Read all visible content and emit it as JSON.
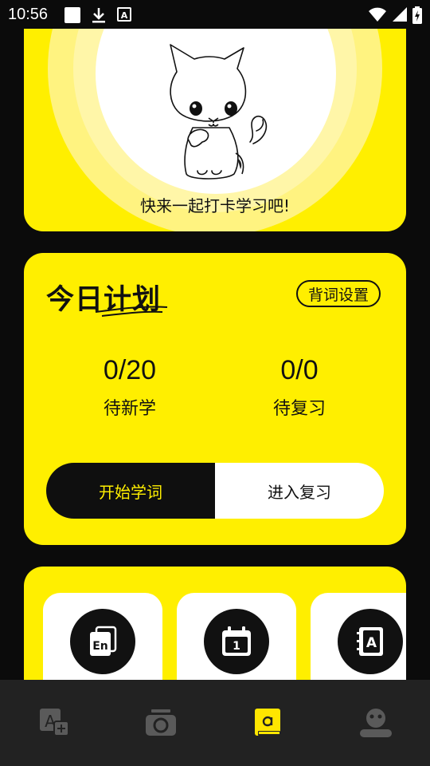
{
  "status_bar": {
    "time": "10:56",
    "notification_icons": [
      "blank-notification-icon",
      "download-icon",
      "translate-a-icon"
    ],
    "system_icons": [
      "wifi-icon",
      "signal-icon",
      "battery-charging-icon"
    ]
  },
  "banner": {
    "caption": "快来一起打卡学习吧!",
    "image": "cat-illustration"
  },
  "plan": {
    "title": "今日计划",
    "settings_label": "背词设置",
    "stats": [
      {
        "value": "0/20",
        "label": "待新学"
      },
      {
        "value": "0/0",
        "label": "待复习"
      }
    ],
    "start_label": "开始学词",
    "review_label": "进入复习"
  },
  "tools": {
    "items": [
      {
        "icon": "en-card-icon"
      },
      {
        "icon": "calendar-icon",
        "day": "1"
      },
      {
        "icon": "a-notebook-icon",
        "letter": "A"
      }
    ]
  },
  "nav": {
    "items": [
      {
        "icon": "translate-icon",
        "active": false
      },
      {
        "icon": "camera-icon",
        "active": false
      },
      {
        "icon": "book-icon",
        "active": true
      },
      {
        "icon": "profile-icon",
        "active": false
      }
    ],
    "active_color": "#FFE600",
    "inactive_color": "#5a5a5a"
  },
  "colors": {
    "brand_yellow": "#FFEF00",
    "background": "#0b0b0b",
    "dark": "#111111"
  }
}
